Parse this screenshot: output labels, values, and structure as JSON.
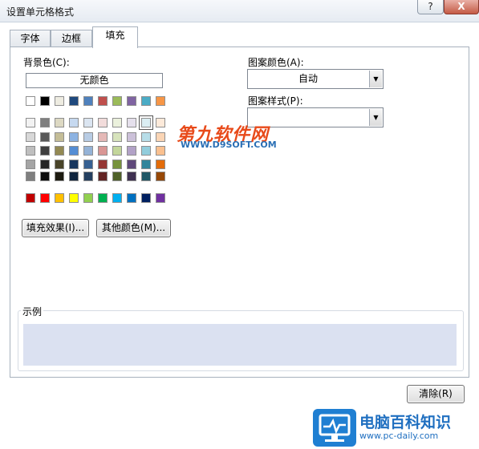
{
  "window": {
    "title": "设置单元格格式",
    "help_label": "?",
    "close_label": "X"
  },
  "tabs": [
    {
      "label": "字体",
      "active": false
    },
    {
      "label": "边框",
      "active": false
    },
    {
      "label": "填充",
      "active": true
    }
  ],
  "fill": {
    "bg_label": "背景色(C):",
    "no_color": "无颜色",
    "fill_effects": "填充效果(I)...",
    "more_colors": "其他颜色(M)...",
    "pattern_color_label": "图案颜色(A):",
    "pattern_color_value": "自动",
    "pattern_style_label": "图案样式(P):",
    "pattern_style_value": "",
    "sample_label": "示例",
    "sample_color": "#dbe1f1",
    "selected_swatch": "light blue-gray (row 1, col 9)"
  },
  "palette": {
    "theme_top": [
      "#ffffff",
      "#000000",
      "#eeece1",
      "#1f497d",
      "#4f81bd",
      "#c0504d",
      "#9bbb59",
      "#8064a2",
      "#4bacc6",
      "#f79646"
    ],
    "theme_rows": [
      [
        "#f2f2f2",
        "#7f7f7f",
        "#ddd9c3",
        "#c6d9f0",
        "#dbe5f1",
        "#f2dcdb",
        "#ebf1dd",
        "#e5e0ec",
        "#dbeef3",
        "#fdeada"
      ],
      [
        "#d8d8d8",
        "#595959",
        "#c4bd97",
        "#8db3e2",
        "#b8cce4",
        "#e5b9b7",
        "#d7e3bc",
        "#ccc1d9",
        "#b7dde8",
        "#fbd5b5"
      ],
      [
        "#bfbfbf",
        "#3f3f3f",
        "#938953",
        "#548dd4",
        "#95b3d7",
        "#d99694",
        "#c3d69b",
        "#b2a2c7",
        "#92cddc",
        "#fac08f"
      ],
      [
        "#a5a5a5",
        "#262626",
        "#494429",
        "#17365d",
        "#366092",
        "#953734",
        "#76923c",
        "#5f497a",
        "#31859b",
        "#e36c09"
      ],
      [
        "#7f7f7f",
        "#0c0c0c",
        "#1d1b10",
        "#0f243e",
        "#244061",
        "#632423",
        "#4f6128",
        "#3f3151",
        "#205867",
        "#974806"
      ]
    ],
    "standard": [
      "#c00000",
      "#ff0000",
      "#ffc000",
      "#ffff00",
      "#92d050",
      "#00b050",
      "#00b0f0",
      "#0070c0",
      "#002060",
      "#7030a0"
    ]
  },
  "footer": {
    "clear_label": "清除(R)"
  },
  "watermarks": {
    "site_name": "第九软件网",
    "site_url": "WWW.D9SOFT.COM",
    "logo_name": "电脑百科知识",
    "logo_url": "www.pc-daily.com"
  }
}
